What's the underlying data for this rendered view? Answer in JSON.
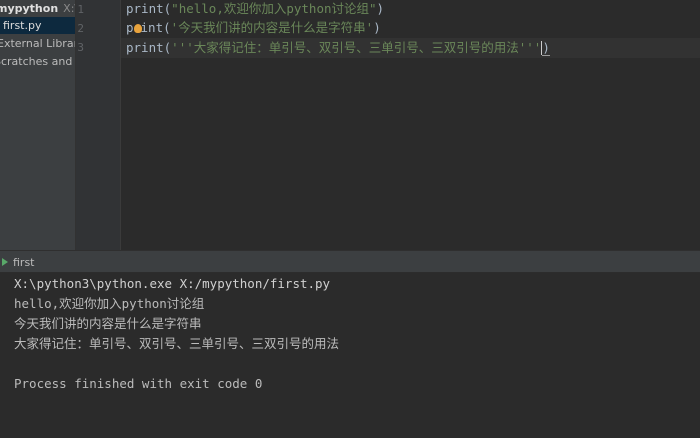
{
  "project": {
    "root_name": "mypython",
    "root_path": "X:\\mypython",
    "file": "first.py",
    "external_libraries": "External Libraries",
    "scratches": "Scratches and Consoles"
  },
  "editor": {
    "line_numbers": [
      "1",
      "2",
      "3"
    ],
    "lines": [
      {
        "fn": "print",
        "open": "(",
        "str": "\"hello,欢迎你加入python讨论组\"",
        "close": ")"
      },
      {
        "fn_a": "p",
        "fn_b": "int",
        "open": "(",
        "str": "'今天我们讲的内容是什么是字符串'",
        "close": ")"
      },
      {
        "fn": "print",
        "open": "(",
        "str": "'''大家得记住：单引号、双引号、三单引号、三双引号的用法'''",
        "close": ")"
      }
    ]
  },
  "run": {
    "tab_label": "first",
    "console": [
      "X:\\python3\\python.exe X:/mypython/first.py",
      "hello,欢迎你加入python讨论组",
      "今天我们讲的内容是什么是字符串",
      "大家得记住：单引号、双引号、三单引号、三双引号的用法",
      "",
      "Process finished with exit code 0"
    ]
  },
  "colors": {
    "editor_bg": "#2b2b2b",
    "sidebar_bg": "#3c3f41",
    "string": "#6a8759",
    "selected_row": "#0d293e",
    "run_icon": "#59a869"
  }
}
